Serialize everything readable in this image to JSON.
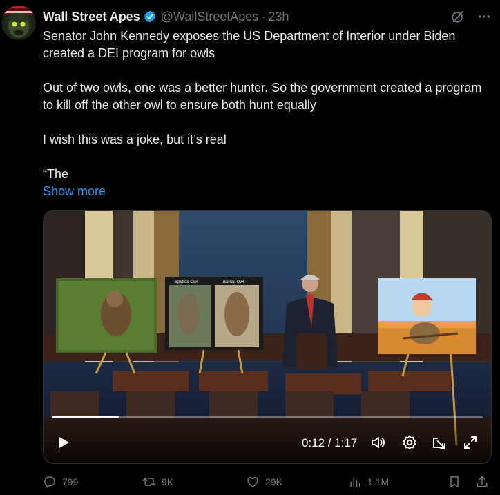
{
  "author": {
    "name": "Wall Street Apes",
    "handle": "@WallStreetApes",
    "time": "23h",
    "separator": "·"
  },
  "tweet": {
    "paragraphs": [
      "Senator John Kennedy exposes the US Department of Interior under Biden created a DEI program for owls",
      "Out of two owls, one was a better hunter. So the government created a program to kill off the other owl to ensure both hunt equally",
      "I wish this was a joke, but it’s real",
      "“The"
    ],
    "show_more": "Show more"
  },
  "video": {
    "poster_left_label": "Spotted Owl",
    "poster_right_label": "Barred Owl",
    "time_current": "0:12",
    "time_total": "1:17",
    "time_display": "0:12 / 1:17",
    "progress_fraction": 0.156
  },
  "actions": {
    "replies": "799",
    "reposts": "9K",
    "likes": "29K",
    "views": "1.1M"
  },
  "colors": {
    "accent": "#1d9bf0",
    "text": "#e7e9ea",
    "muted": "#71767b",
    "background": "#000000"
  },
  "icons": [
    "verified-badge-icon",
    "grok-icon",
    "more-icon",
    "play-icon",
    "volume-icon",
    "settings-icon",
    "pip-icon",
    "fullscreen-icon",
    "reply-icon",
    "repost-icon",
    "like-icon",
    "views-icon",
    "bookmark-icon",
    "share-icon"
  ]
}
